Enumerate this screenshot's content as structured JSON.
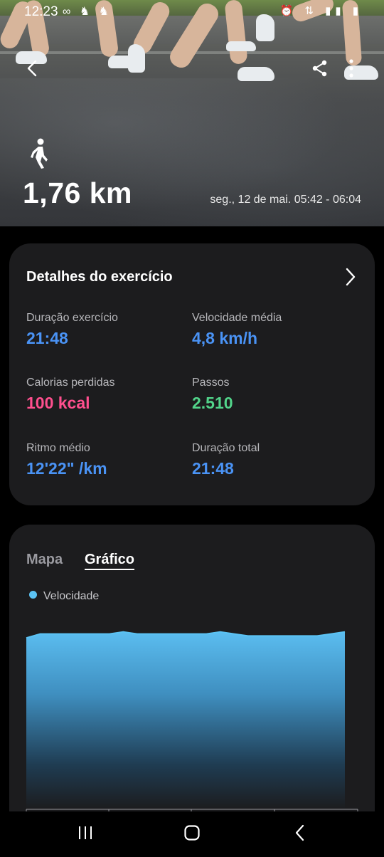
{
  "status_bar": {
    "time": "12:23"
  },
  "hero": {
    "distance": "1,76 km",
    "datetime": "seg., 12 de mai. 05:42 - 06:04",
    "activity_icon": "walking-icon"
  },
  "details": {
    "title": "Detalhes do exercício",
    "stats": [
      {
        "label": "Duração exercício",
        "value": "21:48",
        "color": "#4a93f5"
      },
      {
        "label": "Velocidade média",
        "value": "4,8 km/h",
        "color": "#4a93f5"
      },
      {
        "label": "Calorias perdidas",
        "value": "100 kcal",
        "color": "#ff4f8e"
      },
      {
        "label": "Passos",
        "value": "2.510",
        "color": "#52d48a"
      },
      {
        "label": "Ritmo médio",
        "value": "12'22\" /km",
        "color": "#4a93f5"
      },
      {
        "label": "Duração total",
        "value": "21:48",
        "color": "#4a93f5"
      }
    ]
  },
  "chart_section": {
    "tabs": [
      "Mapa",
      "Gráfico"
    ],
    "selected_tab": "Gráfico",
    "legend": "Velocidade"
  },
  "chart_data": {
    "type": "area",
    "series": [
      {
        "name": "Velocidade",
        "color": "#5bc3f4",
        "values": [
          0.86,
          0.88,
          0.88,
          0.88,
          0.88,
          0.88,
          0.88,
          0.89,
          0.88,
          0.88,
          0.88,
          0.88,
          0.88,
          0.88,
          0.89,
          0.88,
          0.87,
          0.87,
          0.87,
          0.87,
          0.87,
          0.87,
          0.88,
          0.89
        ]
      }
    ]
  },
  "colors": {
    "accent_blue": "#4a93f5",
    "calorie_pink": "#ff4f8e",
    "steps_green": "#52d48a",
    "card_bg": "#1c1c1e"
  }
}
